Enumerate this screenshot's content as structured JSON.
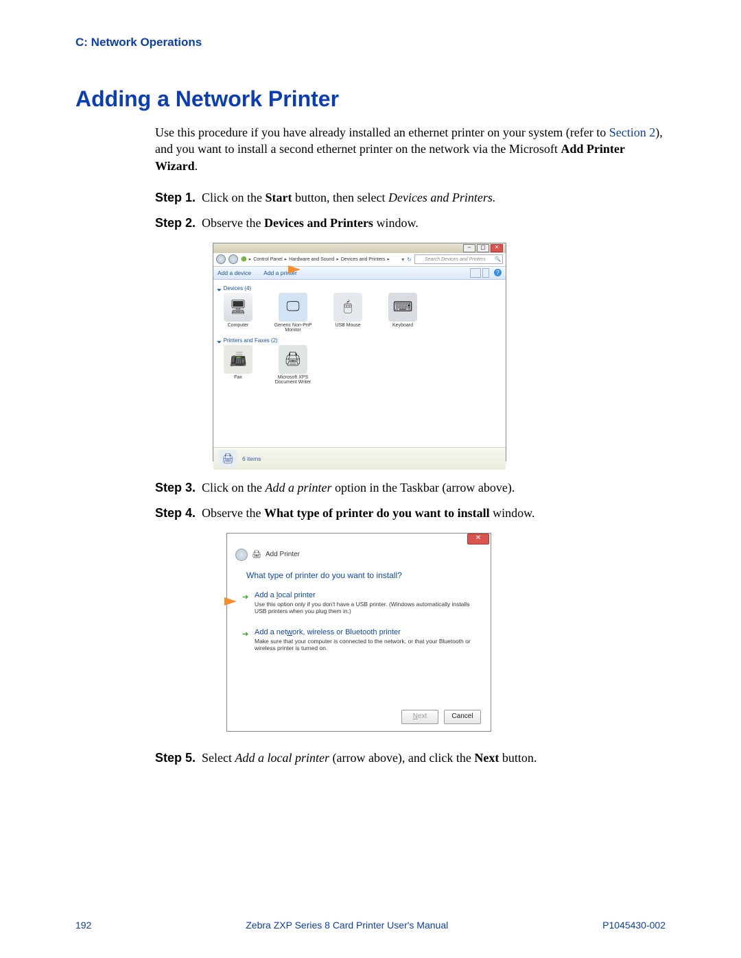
{
  "header": {
    "section_label": "C: Network Operations"
  },
  "heading": "Adding a Network Printer",
  "intro": {
    "part1": "Use this procedure if you have already installed an ethernet printer on your system (refer to ",
    "link": "Section 2",
    "part2": "), and you want to install a second ethernet printer on the network via the Microsoft ",
    "bold_tail": "Add Printer Wizard",
    "tail": "."
  },
  "steps": {
    "s1_label": "Step 1.",
    "s1_a": "Click on the ",
    "s1_b": "Start",
    "s1_c": " button, then select ",
    "s1_d": "Devices and Printers.",
    "s2_label": "Step 2.",
    "s2_a": "Observe the ",
    "s2_b": "Devices and Printers",
    "s2_c": " window.",
    "s3_label": "Step 3.",
    "s3_a": "Click on the ",
    "s3_b": "Add a printer",
    "s3_c": " option in the Taskbar (arrow above).",
    "s4_label": "Step 4.",
    "s4_a": "Observe the ",
    "s4_b": "What type of printer do you want to install",
    "s4_c": " window.",
    "s5_label": "Step 5.",
    "s5_a": "Select ",
    "s5_b": "Add a local printer",
    "s5_c": " (arrow above), and click the ",
    "s5_d": "Next",
    "s5_e": " button."
  },
  "screenshot1": {
    "breadcrumbs": [
      "Control Panel",
      "Hardware and Sound",
      "Devices and Printers"
    ],
    "search_placeholder": "Search Devices and Printers",
    "toolbar": {
      "add_device": "Add a device",
      "add_printer": "Add a printer"
    },
    "categories": {
      "devices_label": "Devices (4)",
      "printers_label": "Printers and Faxes (2)"
    },
    "devices": [
      {
        "name": "Computer",
        "icon": "🖥"
      },
      {
        "name": "Generic Non-PnP Monitor",
        "icon": "🖵"
      },
      {
        "name": "USB Mouse",
        "icon": "🖱"
      },
      {
        "name": "Keyboard",
        "icon": "⌨"
      }
    ],
    "printers": [
      {
        "name": "Fax",
        "icon": "📠"
      },
      {
        "name": "Microsoft XPS Document Writer",
        "icon": "🖨"
      }
    ],
    "status": "6 items"
  },
  "screenshot2": {
    "window_title": "Add Printer",
    "question": "What type of printer do you want to install?",
    "option1": {
      "title": "Add a local printer",
      "desc": "Use this option only if you don't have a USB printer. (Windows automatically installs USB printers when you plug them in.)"
    },
    "option2": {
      "title": "Add a network, wireless or Bluetooth printer",
      "desc": "Make sure that your computer is connected to the network, or that your Bluetooth or wireless printer is turned on."
    },
    "next_label": "Next",
    "cancel_label": "Cancel"
  },
  "footer": {
    "page": "192",
    "title": "Zebra ZXP Series 8 Card Printer User's Manual",
    "code": "P1045430-002"
  }
}
